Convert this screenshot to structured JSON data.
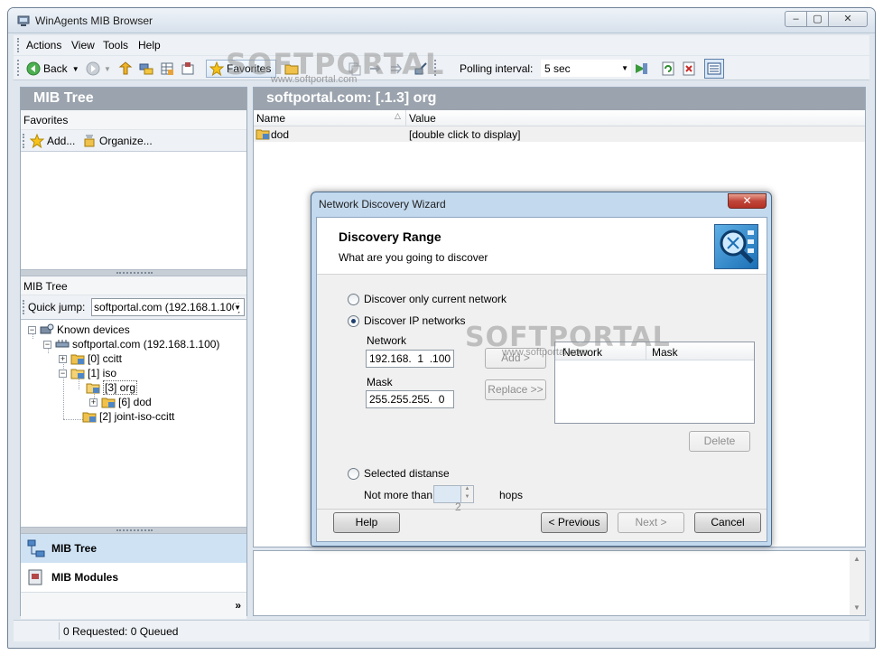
{
  "window": {
    "title": "WinAgents MIB Browser",
    "min": "–",
    "max": "▢",
    "close": "✕"
  },
  "menu": [
    "Actions",
    "View",
    "Tools",
    "Help"
  ],
  "toolbar": {
    "back_label": "Back",
    "favorites_label": "Favorites",
    "polling_label": "Polling interval:",
    "polling_value": "5 sec"
  },
  "left": {
    "title": "MIB Tree",
    "favorites_header": "Favorites",
    "add_label": "Add...",
    "organize_label": "Organize...",
    "mibtree_header": "MIB Tree",
    "quick_jump_label": "Quick jump:",
    "quick_jump_value": "softportal.com (192.168.1.100)",
    "tree": [
      "Known devices",
      "softportal.com (192.168.1.100)",
      "[0] ccitt",
      "[1] iso",
      "[3] org",
      "[6] dod",
      "[2] joint-iso-ccitt"
    ],
    "nav": {
      "mib_tree": "MIB Tree",
      "mib_modules": "MIB Modules",
      "more": "»"
    }
  },
  "right": {
    "title": "softportal.com: [.1.3] org",
    "col_name": "Name",
    "col_value": "Value",
    "rows": [
      {
        "name": "dod",
        "value": "[double click to display]"
      }
    ]
  },
  "status": {
    "text": "0 Requested: 0 Queued"
  },
  "dialog": {
    "title": "Network Discovery Wizard",
    "close": "✕",
    "heading": "Discovery Range",
    "subheading": "What are you going to discover",
    "radio_current": "Discover only current network",
    "radio_ip": "Discover IP networks",
    "network_label": "Network",
    "network_value": "192.168.  1  .100",
    "mask_label": "Mask",
    "mask_value": "255.255.255.  0",
    "add_btn": "Add >",
    "replace_btn": "Replace >>",
    "list_col_network": "Network",
    "list_col_mask": "Mask",
    "delete_btn": "Delete",
    "radio_selected": "Selected distanse",
    "not_more_label": "Not more than",
    "hops_value": "2",
    "hops_label": "hops",
    "help_btn": "Help",
    "prev_btn": "< Previous",
    "next_btn": "Next >",
    "cancel_btn": "Cancel"
  },
  "watermark": {
    "text": "SOFTPORTAL",
    "sub": "www.softportal.com"
  }
}
